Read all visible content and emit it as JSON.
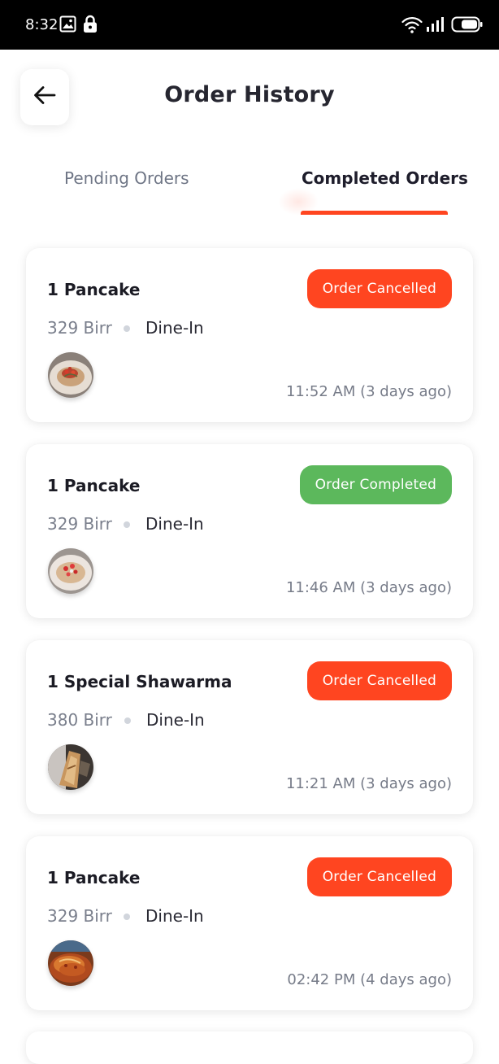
{
  "status_bar": {
    "time": "8:32",
    "left_icons": [
      "image-icon",
      "lock-icon"
    ],
    "right_icons": [
      "wifi-icon",
      "signal-icon",
      "battery-icon"
    ]
  },
  "header": {
    "title": "Order History",
    "back_icon": "arrow-left-icon"
  },
  "tabs": [
    {
      "label": "Pending Orders",
      "active": false
    },
    {
      "label": "Completed Orders",
      "active": true
    }
  ],
  "colors": {
    "accent": "#ff4520",
    "cancelled": "#ff4520",
    "completed": "#5cb85c",
    "muted_text": "#7a7f8c",
    "title_text": "#262630"
  },
  "orders": [
    {
      "title": "1 Pancake",
      "price": "329 Birr",
      "type": "Dine-In",
      "status": "Order Cancelled",
      "status_kind": "cancelled",
      "time": "11:52 AM (3 days ago)"
    },
    {
      "title": "1 Pancake",
      "price": "329 Birr",
      "type": "Dine-In",
      "status": "Order Completed",
      "status_kind": "completed",
      "time": "11:46 AM (3 days ago)"
    },
    {
      "title": "1 Special Shawarma",
      "price": "380 Birr",
      "type": "Dine-In",
      "status": "Order Cancelled",
      "status_kind": "cancelled",
      "time": "11:21 AM (3 days ago)"
    },
    {
      "title": "1 Pancake",
      "price": "329 Birr",
      "type": "Dine-In",
      "status": "Order Cancelled",
      "status_kind": "cancelled",
      "time": "02:42 PM (4 days ago)"
    }
  ]
}
